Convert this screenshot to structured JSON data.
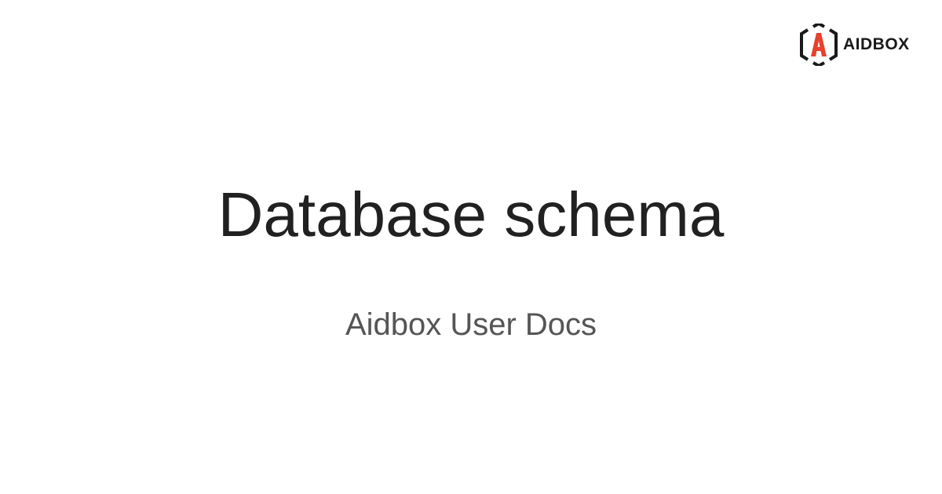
{
  "brand": {
    "name": "AIDBOX",
    "accent": "#e8412c"
  },
  "title": "Database schema",
  "subtitle": "Aidbox User Docs"
}
